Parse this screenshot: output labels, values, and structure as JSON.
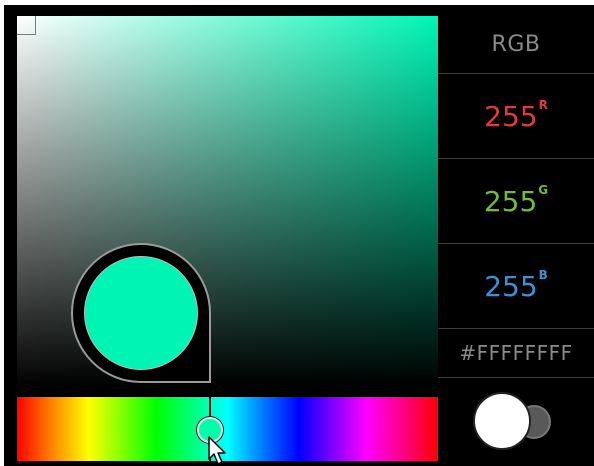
{
  "picker": {
    "current_color": "#00f5b4",
    "hue_color": "#00ffaa",
    "hue_position_fraction": 0.458,
    "mode_label": "RGB",
    "channels": [
      {
        "value": "255",
        "superscript": "R",
        "color": "#e23a3a"
      },
      {
        "value": "255",
        "superscript": "G",
        "color": "#6fbd3b"
      },
      {
        "value": "255",
        "superscript": "B",
        "color": "#3f8fd2"
      }
    ],
    "hex_value": "#FFFFFFFF",
    "new_swatch_color": "#ffffff",
    "old_swatch_color": "#595959",
    "cursor_icon": "mouse-pointer-icon"
  }
}
